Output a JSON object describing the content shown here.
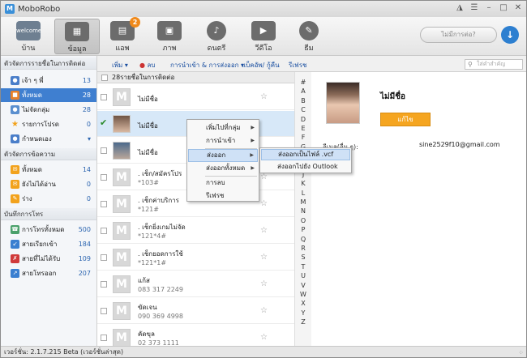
{
  "app": {
    "title": "MoboRobo",
    "logo": "M",
    "version": "เวอร์ชั่น: 2.1.7.215 Beta  (เวอร์ชั่นล่าสุด)"
  },
  "window_controls": [
    "shirt-icon",
    "menu-icon",
    "minimize-icon",
    "maximize-icon",
    "close-icon"
  ],
  "nav": [
    {
      "label": "บ้าน",
      "icon": "welcome"
    },
    {
      "label": "ข้อมูล",
      "icon": "▦"
    },
    {
      "label": "แอพ",
      "icon": "▤",
      "badge": "2"
    },
    {
      "label": "ภาพ",
      "icon": "▣"
    },
    {
      "label": "ดนตรี",
      "icon": "♪"
    },
    {
      "label": "วีดีโอ",
      "icon": "▶"
    },
    {
      "label": "ธีม",
      "icon": "✎"
    }
  ],
  "connect_label": "ไม่มีการต่อ?",
  "toolbar2": {
    "add": "เพิ่ม",
    "delete": "ลบ",
    "import_export": "การนำเข้า & การส่งออก",
    "backup_restore": "แบ็คอัพ/ กู้คืน",
    "refresh": "รีเฟรช",
    "search_placeholder": "ใส่คำสำคัญ"
  },
  "sidebar": {
    "section1": "ตัวจัดการรายชื่อในการติดต่อ",
    "contacts": [
      {
        "label": "เจ้า ๆ พี่",
        "count": "13",
        "color": "#4a7ec9"
      },
      {
        "label": "ทั้งหมด",
        "count": "28",
        "color": "#e8812a"
      },
      {
        "label": "ไม่จัดกลุ่ม",
        "count": "28",
        "color": "#5a8fcf"
      },
      {
        "label": "รายการโปรด",
        "count": "0",
        "color": "#f2a21c"
      },
      {
        "label": "กำหนดเอง",
        "count": "",
        "color": "#4a7ec9"
      }
    ],
    "section2": "ตัวจัดการข้อความ",
    "messages": [
      {
        "label": "ทั้งหมด",
        "count": "14",
        "color": "#f2a21c"
      },
      {
        "label": "ยังไม่ได้อ่าน",
        "count": "0",
        "color": "#f2a21c"
      },
      {
        "label": "ร่าง",
        "count": "0",
        "color": "#f2a21c"
      }
    ],
    "section3": "บันทึกการโทร",
    "calls": [
      {
        "label": "การโทรทั้งหมด",
        "count": "500",
        "color": "#4aa06a"
      },
      {
        "label": "สายเรียกเข้า",
        "count": "184",
        "color": "#3a7fd0"
      },
      {
        "label": "สายที่ไม่ได้รับ",
        "count": "109",
        "color": "#d03a3a"
      },
      {
        "label": "สายโทรออก",
        "count": "207",
        "color": "#3a7fd0"
      }
    ]
  },
  "list": {
    "header": "28รายชื่อในการติดต่อ",
    "rows": [
      {
        "name": "ไม่มีชื่อ",
        "phone": "",
        "avatar": "placeholder"
      },
      {
        "name": "ไม่มีชื่อ",
        "phone": "",
        "avatar": "photo"
      },
      {
        "name": "ไม่มีชื่อ",
        "phone": "",
        "avatar": "photo2"
      },
      {
        "name": ". เช็ก/สมัครโปร",
        "phone": "*103#",
        "avatar": "placeholder"
      },
      {
        "name": ". เช็กค่าบริการ",
        "phone": "*121#",
        "avatar": "placeholder"
      },
      {
        "name": ". เช็กยิ่งเกมไม่จัด",
        "phone": "*121*4#",
        "avatar": "placeholder"
      },
      {
        "name": ". เช็กยอดการใช้",
        "phone": "*121*1#",
        "avatar": "placeholder"
      },
      {
        "name": "แก้ส",
        "phone": "083 317 2249",
        "avatar": "placeholder"
      },
      {
        "name": "ขัดเจน",
        "phone": "090 369 4998",
        "avatar": "placeholder"
      },
      {
        "name": "คัดขุล",
        "phone": "02 373 1111",
        "avatar": "placeholder"
      }
    ]
  },
  "alphabet": [
    "#",
    "A",
    "B",
    "C",
    "D",
    "E",
    "F",
    "G",
    "H",
    "I",
    "J",
    "K",
    "L",
    "M",
    "N",
    "O",
    "P",
    "Q",
    "R",
    "S",
    "T",
    "U",
    "V",
    "W",
    "X",
    "Y",
    "Z"
  ],
  "detail": {
    "name": "ไม่มีชื่อ",
    "edit": "แก้ไข",
    "email_label": "อีเมล(อื่น ๆ):",
    "email": "sine2529f10@gmail.com"
  },
  "context_menu": {
    "add_to_group": "เพิ่มไปที่กลุ่ม",
    "import": "การนำเข้า",
    "export": "ส่งออก",
    "export_all": "ส่งออกทั้งหมด",
    "delete": "การลบ",
    "refresh": "รีเฟรช"
  },
  "submenu": {
    "vcf": "ส่งออกเป็นไฟล์ .vcf",
    "outlook": "ส่งออกไปยัง Outlook"
  },
  "colors": {
    "accent": "#3f7fd0",
    "edit_button": "#f5a520",
    "badge": "#f08a1c"
  }
}
